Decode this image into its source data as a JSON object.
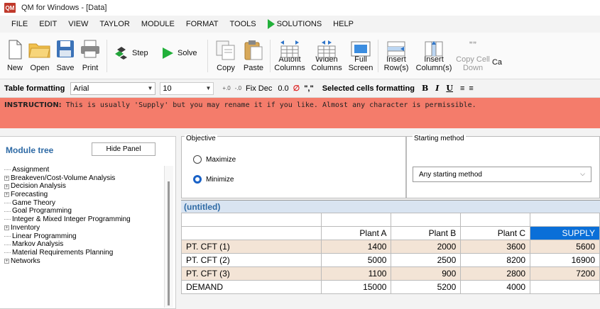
{
  "window": {
    "title": "QM for Windows - [Data]",
    "logo": "QM"
  },
  "menu": [
    "FILE",
    "EDIT",
    "VIEW",
    "TAYLOR",
    "MODULE",
    "FORMAT",
    "TOOLS",
    "SOLUTIONS",
    "HELP"
  ],
  "toolbar": {
    "new": "New",
    "open": "Open",
    "save": "Save",
    "print": "Print",
    "step": "Step",
    "solve": "Solve",
    "copy": "Copy",
    "paste": "Paste",
    "autofit": "Autofit Columns",
    "widen": "Widen Columns",
    "full": "Full Screen",
    "insert_row": "Insert Row(s)",
    "insert_col": "Insert Column(s)",
    "copy_down": "Copy Cell Down",
    "cut_label": "Ca"
  },
  "format": {
    "table_formatting": "Table formatting",
    "font": "Arial",
    "size": "10",
    "fix_dec": "Fix Dec",
    "zero": "0.0",
    "comma": "\",\"",
    "selected": "Selected cells formatting",
    "bold": "B",
    "italic": "I",
    "underline": "U"
  },
  "instruction": {
    "label": "INSTRUCTION:",
    "text": "This is usually 'Supply' but you may rename it if you like. Almost any character is permissible."
  },
  "sidebar": {
    "title": "Module tree",
    "hide_button": "Hide Panel",
    "items": [
      {
        "label": "Assignment",
        "expandable": false
      },
      {
        "label": "Breakeven/Cost-Volume Analysis",
        "expandable": true
      },
      {
        "label": "Decision Analysis",
        "expandable": true
      },
      {
        "label": "Forecasting",
        "expandable": true
      },
      {
        "label": "Game Theory",
        "expandable": false
      },
      {
        "label": "Goal Programming",
        "expandable": false
      },
      {
        "label": "Integer & Mixed Integer Programming",
        "expandable": false
      },
      {
        "label": "Inventory",
        "expandable": true
      },
      {
        "label": "Linear Programming",
        "expandable": false
      },
      {
        "label": "Markov Analysis",
        "expandable": false
      },
      {
        "label": "Material Requirements Planning",
        "expandable": false
      },
      {
        "label": "Networks",
        "expandable": true
      }
    ]
  },
  "objective": {
    "label": "Objective",
    "maximize": "Maximize",
    "minimize": "Minimize",
    "selected": "Minimize"
  },
  "starting": {
    "label": "Starting method",
    "value": "Any starting method"
  },
  "table": {
    "title": "(untitled)",
    "headers": [
      "",
      "Plant A",
      "Plant B",
      "Plant C",
      "SUPPLY"
    ],
    "rows": [
      {
        "name": "PT. CFT (1)",
        "values": [
          "1400",
          "2000",
          "3600",
          "5600"
        ]
      },
      {
        "name": "PT. CFT (2)",
        "values": [
          "5000",
          "2500",
          "8200",
          "16900"
        ]
      },
      {
        "name": "PT. CFT (3)",
        "values": [
          "1100",
          "900",
          "2800",
          "7200"
        ]
      },
      {
        "name": "DEMAND",
        "values": [
          "15000",
          "5200",
          "4000",
          ""
        ]
      }
    ]
  }
}
